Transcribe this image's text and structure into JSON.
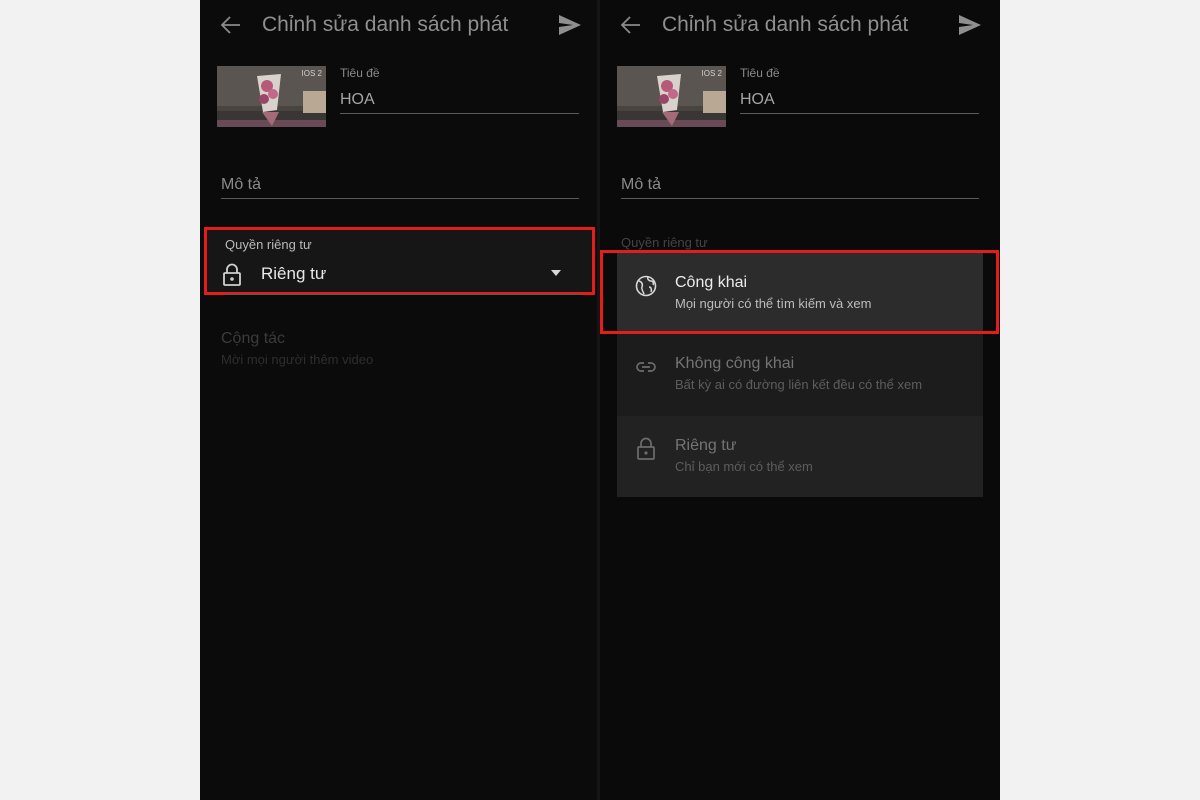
{
  "screens": [
    {
      "header": {
        "title": "Chỉnh sửa danh sách phát"
      },
      "thumbnail": {
        "badge": "IOS 2"
      },
      "title_field": {
        "label": "Tiêu đề",
        "value": "HOA"
      },
      "description_field": {
        "placeholder": "Mô tả"
      },
      "privacy": {
        "label": "Quyền riêng tư",
        "value": "Riêng tư",
        "icon": "lock-icon"
      },
      "collaborate": {
        "title": "Cộng tác",
        "subtitle": "Mời mọi người thêm video"
      }
    },
    {
      "header": {
        "title": "Chỉnh sửa danh sách phát"
      },
      "thumbnail": {
        "badge": "IOS 2"
      },
      "title_field": {
        "label": "Tiêu đề",
        "value": "HOA"
      },
      "description_field": {
        "placeholder": "Mô tả"
      },
      "privacy": {
        "label": "Quyền riêng tư"
      },
      "privacy_options": [
        {
          "title": "Công khai",
          "subtitle": "Mọi người có thể tìm kiếm và xem",
          "icon": "globe-icon",
          "selected": true
        },
        {
          "title": "Không công khai",
          "subtitle": "Bất kỳ ai có đường liên kết đều có thể xem",
          "icon": "link-icon",
          "selected": false
        },
        {
          "title": "Riêng tư",
          "subtitle": "Chỉ bạn mới có thể xem",
          "icon": "lock-icon",
          "selected": false
        }
      ]
    }
  ],
  "colors": {
    "background": "#0b0b0b",
    "highlight": "#e41c1c",
    "menu_bg": "#1c1c1c",
    "menu_selected_bg": "#2c2c2c"
  }
}
